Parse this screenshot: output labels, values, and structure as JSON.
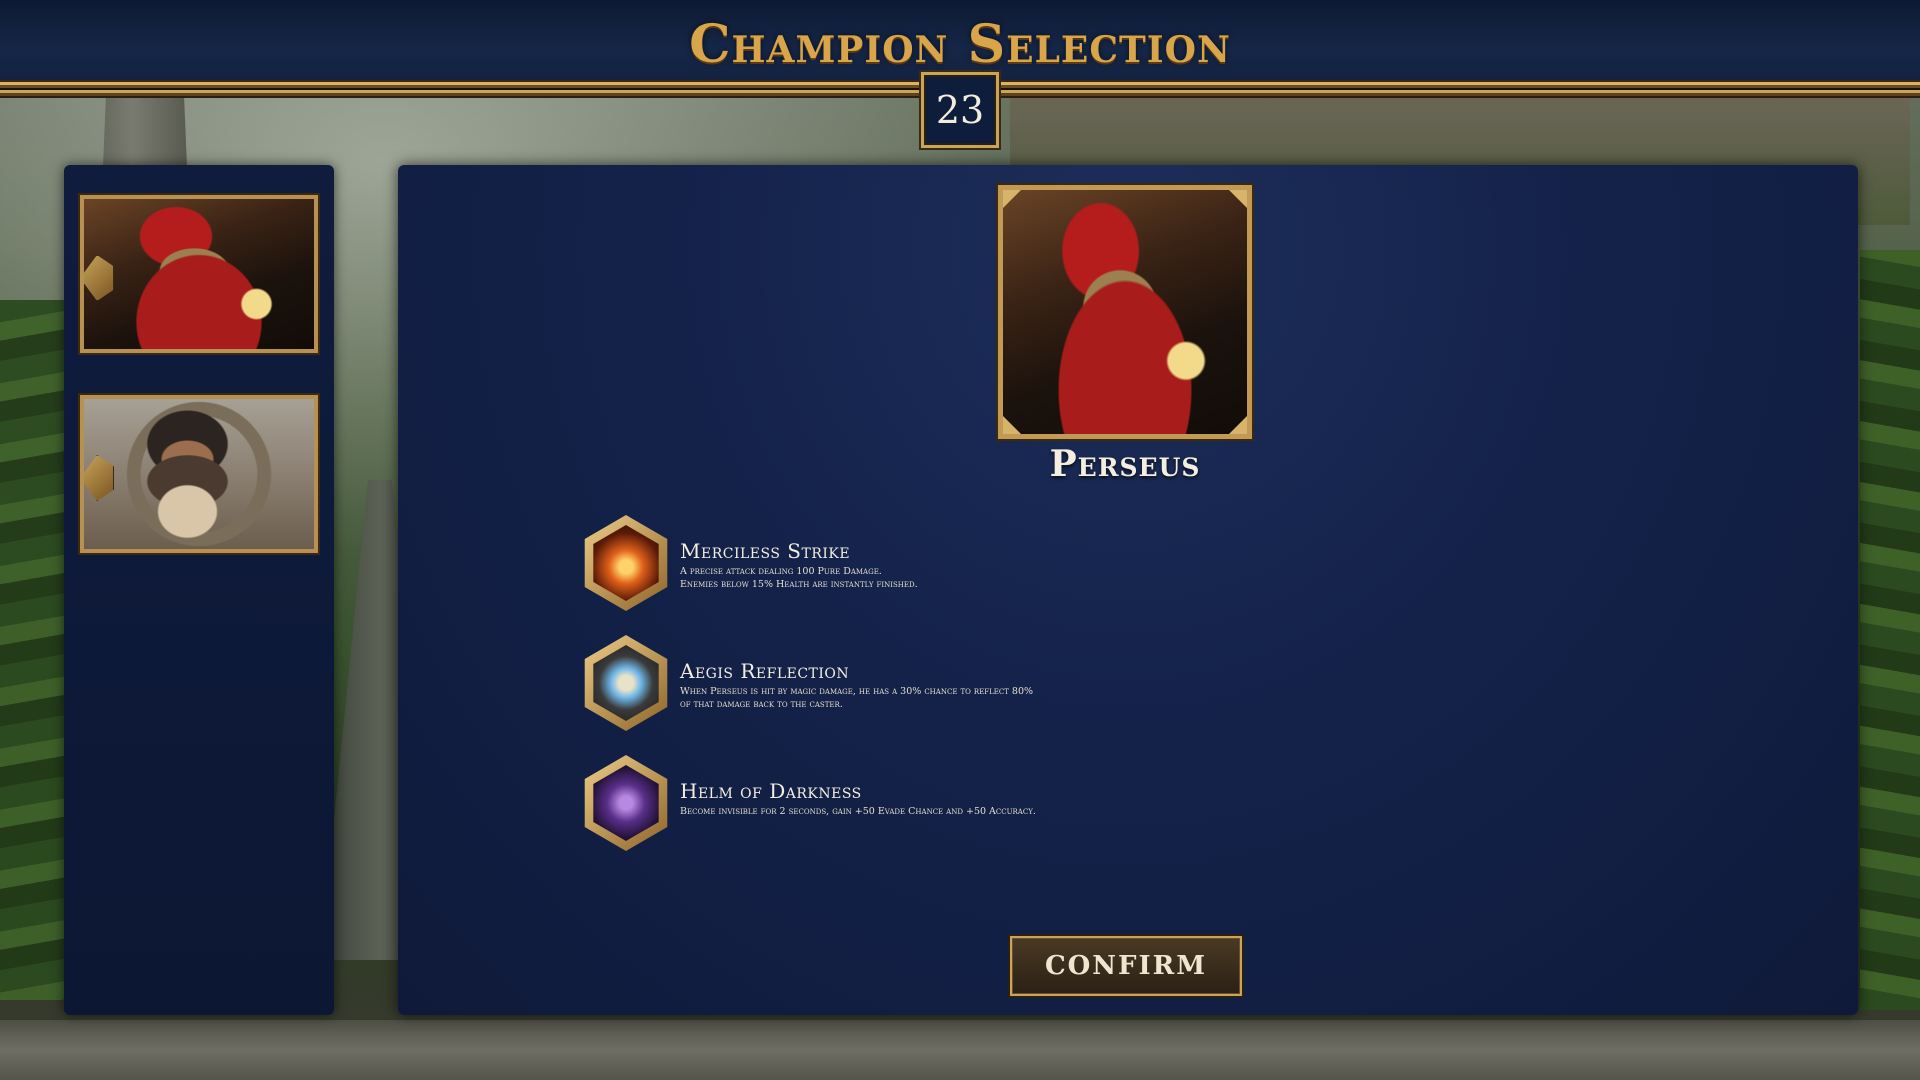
{
  "header": {
    "title": "Champion Selection",
    "timer": "23"
  },
  "roster": {
    "champions": [
      {
        "name": "Perseus",
        "selected": true
      },
      {
        "name": "bearded-warrior",
        "selected": false
      }
    ]
  },
  "selected_champion": {
    "name": "Perseus",
    "abilities": [
      {
        "name": "Merciless Strike",
        "icon": "slash-icon",
        "description_lines": [
          "A precise attack dealing 100 Pure Damage.",
          "Enemies below 15% Health are instantly finished."
        ]
      },
      {
        "name": "Aegis Reflection",
        "icon": "shield-icon",
        "description_lines": [
          "When Perseus is hit by magic damage, he has a 30% chance to reflect 80%",
          "of that damage back to the caster."
        ]
      },
      {
        "name": "Helm of Darkness",
        "icon": "helm-icon",
        "description_lines": [
          "Become invisible for 2 seconds, gain +50 Evade Chance and +50 Accuracy."
        ]
      }
    ]
  },
  "actions": {
    "confirm_label": "CONFIRM"
  },
  "colors": {
    "gold": "#c9a55c",
    "panel_navy": "#14224a",
    "title_gold": "#d9a54a"
  }
}
